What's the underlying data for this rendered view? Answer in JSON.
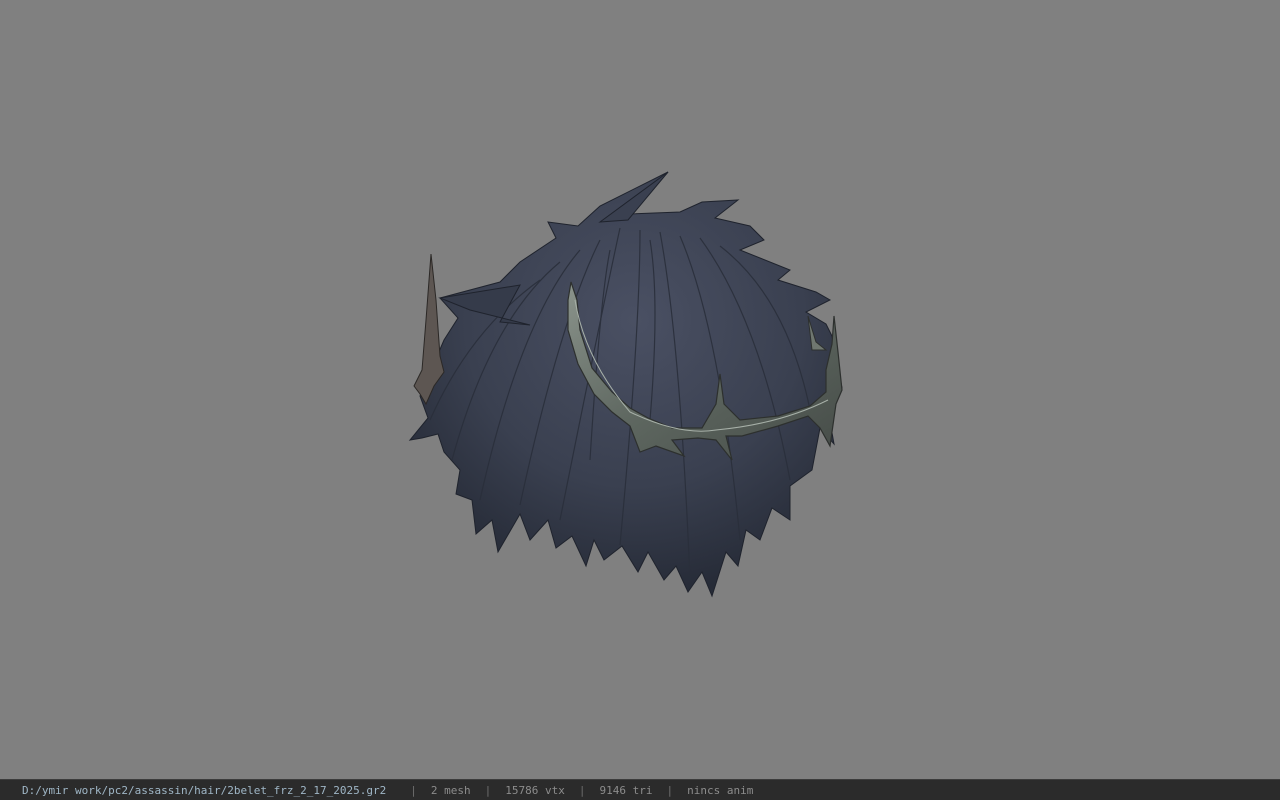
{
  "viewer": {
    "background_color": "#808080",
    "model": {
      "hair_color": "#3c4252",
      "hair_shadow_color": "#262b37",
      "crown_color": "#6f7770"
    }
  },
  "statusbar": {
    "file_path": "D:/ymir work/pc2/assassin/hair/2belet_frz_2_17_2025.gr2",
    "separator": "|",
    "mesh": "2 mesh",
    "vtx": "15786 vtx",
    "tri": "9146 tri",
    "anim": "nincs anim"
  }
}
